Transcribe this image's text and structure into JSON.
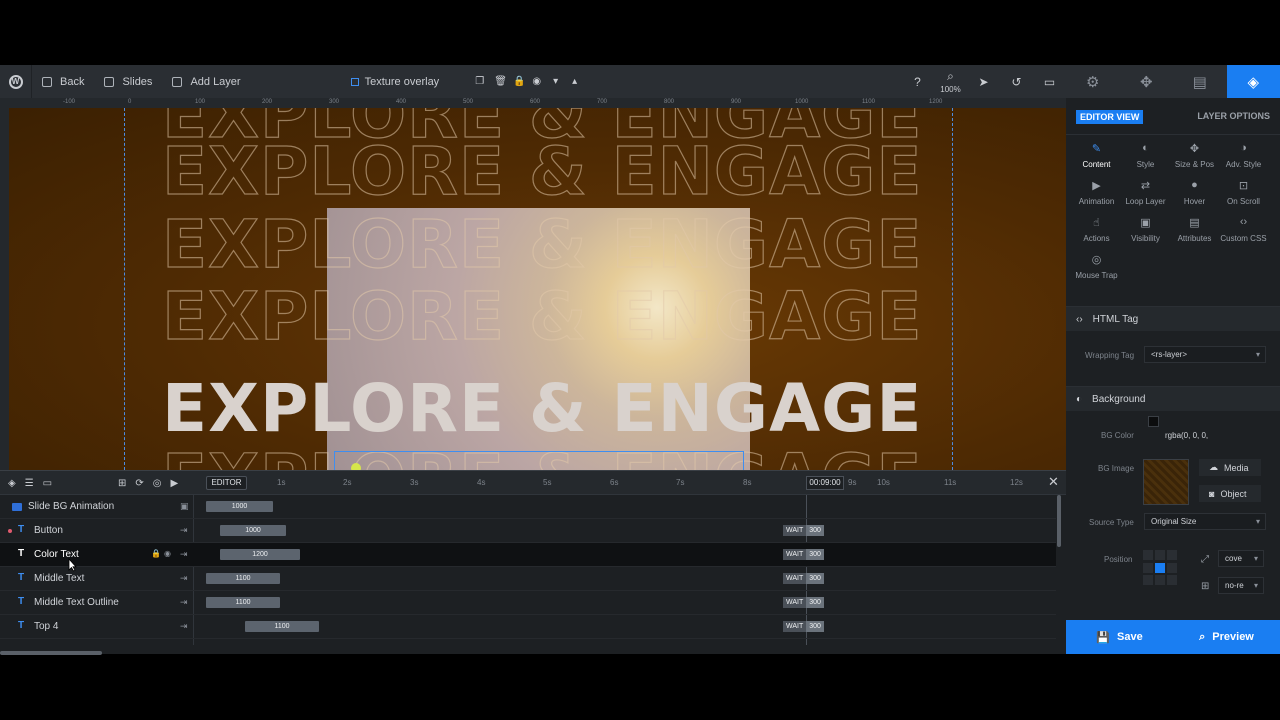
{
  "toolbar": {
    "back_label": "Back",
    "slides_label": "Slides",
    "add_layer_label": "Add Layer",
    "layer_title": "Texture overlay",
    "zoom": "100%"
  },
  "ruler": {
    "marks": [
      "-100",
      "0",
      "100",
      "200",
      "300",
      "400",
      "500",
      "600",
      "700",
      "800",
      "900",
      "1000",
      "1100",
      "1200"
    ]
  },
  "canvas": {
    "headline": "EXPLORE & ENGAGE"
  },
  "timeline": {
    "editor_label": "EDITOR",
    "timecode": "00:09:00",
    "ticks": [
      "1s",
      "2s",
      "3s",
      "4s",
      "5s",
      "6s",
      "7s",
      "8s",
      "9s",
      "10s",
      "11s",
      "12s"
    ],
    "rows": [
      {
        "label": "Slide BG Animation",
        "bar": "1000"
      },
      {
        "label": "Button",
        "bar": "1000",
        "wait": "WAIT",
        "wait_val": "300"
      },
      {
        "label": "Color Text",
        "bar": "1200",
        "wait": "WAIT",
        "wait_val": "300"
      },
      {
        "label": "Middle Text",
        "bar": "1100",
        "wait": "WAIT",
        "wait_val": "300"
      },
      {
        "label": "Middle Text Outline",
        "bar": "1100",
        "wait": "WAIT",
        "wait_val": "300"
      },
      {
        "label": "Top 4",
        "bar": "1100",
        "wait": "WAIT",
        "wait_val": "300"
      }
    ]
  },
  "panel": {
    "editor_view": "EDITOR VIEW",
    "layer_options": "LAYER OPTIONS",
    "options": [
      "Content",
      "Style",
      "Size & Pos",
      "Adv. Style",
      "Animation",
      "Loop Layer",
      "Hover",
      "On Scroll",
      "Actions",
      "Visibility",
      "Attributes",
      "Custom CSS",
      "Mouse Trap"
    ],
    "html_tag_section": "HTML Tag",
    "wrapping_tag_label": "Wrapping Tag",
    "wrapping_tag_value": "<rs-layer>",
    "background_section": "Background",
    "bg_color_label": "BG Color",
    "bg_color_value": "rgba(0, 0, 0,",
    "bg_image_label": "BG Image",
    "media_label": "Media",
    "object_label": "Object",
    "source_type_label": "Source Type",
    "source_type_value": "Original Size",
    "position_label": "Position",
    "size_value": "cove",
    "repeat_value": "no-re"
  },
  "footer": {
    "save_label": "Save",
    "preview_label": "Preview"
  },
  "colors": {
    "accent": "#1a7ef2",
    "canvas_bg": "#4e2a03"
  }
}
